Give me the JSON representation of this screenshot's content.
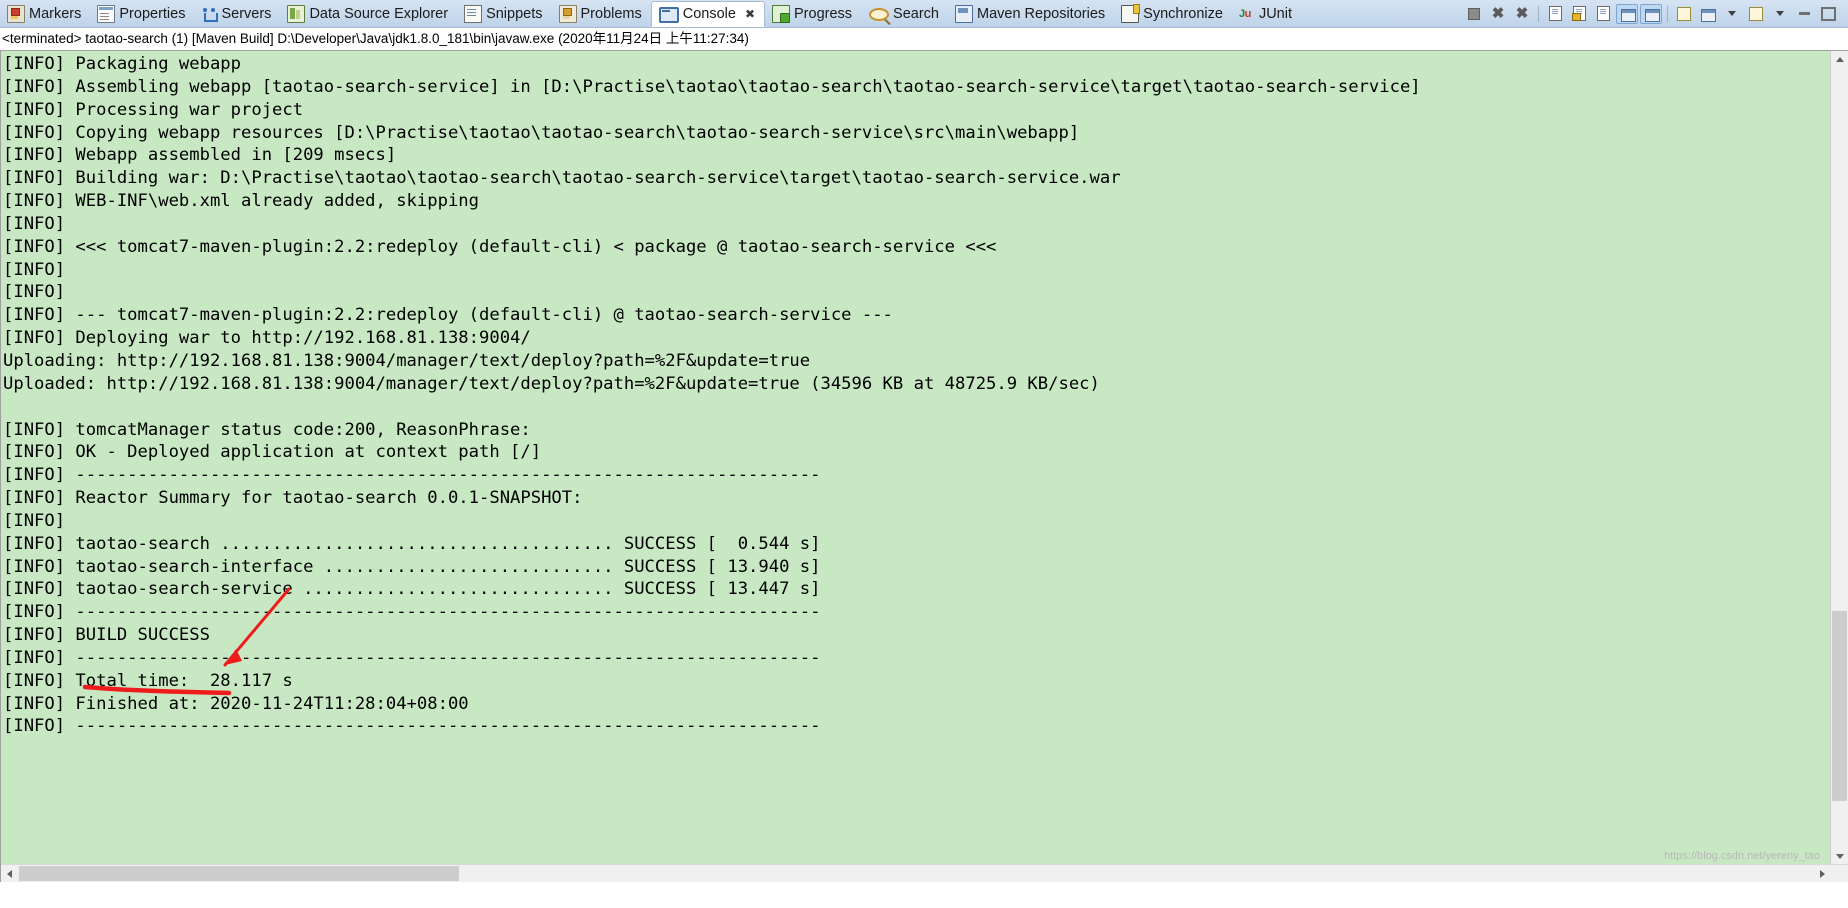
{
  "tabs": [
    {
      "label": "Markers",
      "icon": "marker-icon",
      "active": false
    },
    {
      "label": "Properties",
      "icon": "properties-icon",
      "active": false
    },
    {
      "label": "Servers",
      "icon": "servers-icon",
      "active": false
    },
    {
      "label": "Data Source Explorer",
      "icon": "datasource-icon",
      "active": false
    },
    {
      "label": "Snippets",
      "icon": "snippets-icon",
      "active": false
    },
    {
      "label": "Problems",
      "icon": "problems-icon",
      "active": false
    },
    {
      "label": "Console",
      "icon": "console-icon",
      "active": true
    },
    {
      "label": "Progress",
      "icon": "progress-icon",
      "active": false
    },
    {
      "label": "Search",
      "icon": "search-icon",
      "active": false
    },
    {
      "label": "Maven Repositories",
      "icon": "maven-icon",
      "active": false
    },
    {
      "label": "Synchronize",
      "icon": "sync-icon",
      "active": false
    },
    {
      "label": "JUnit",
      "icon": "junit-icon",
      "active": false
    }
  ],
  "toolbar": {
    "buttons": [
      "terminate-icon",
      "remove-launch-icon",
      "remove-all-terminated-icon",
      "clear-console-icon",
      "scroll-lock-icon",
      "word-wrap-icon",
      "show-console-on-output-icon",
      "show-console-on-error-icon",
      "pin-console-icon",
      "display-selected-console-icon",
      "display-selected-console-menu-icon",
      "open-console-icon",
      "open-console-menu-icon",
      "minimize-icon",
      "maximize-icon"
    ]
  },
  "console": {
    "header": "<terminated> taotao-search (1) [Maven Build] D:\\Developer\\Java\\jdk1.8.0_181\\bin\\javaw.exe (2020年11月24日 上午11:27:34)",
    "background_color": "#c8e8c4",
    "lines": [
      "[INFO] Packaging webapp",
      "[INFO] Assembling webapp [taotao-search-service] in [D:\\Practise\\taotao\\taotao-search\\taotao-search-service\\target\\taotao-search-service]",
      "[INFO] Processing war project",
      "[INFO] Copying webapp resources [D:\\Practise\\taotao\\taotao-search\\taotao-search-service\\src\\main\\webapp]",
      "[INFO] Webapp assembled in [209 msecs]",
      "[INFO] Building war: D:\\Practise\\taotao\\taotao-search\\taotao-search-service\\target\\taotao-search-service.war",
      "[INFO] WEB-INF\\web.xml already added, skipping",
      "[INFO] ",
      "[INFO] <<< tomcat7-maven-plugin:2.2:redeploy (default-cli) < package @ taotao-search-service <<<",
      "[INFO] ",
      "[INFO] ",
      "[INFO] --- tomcat7-maven-plugin:2.2:redeploy (default-cli) @ taotao-search-service ---",
      "[INFO] Deploying war to http://192.168.81.138:9004/",
      "Uploading: http://192.168.81.138:9004/manager/text/deploy?path=%2F&update=true",
      "Uploaded: http://192.168.81.138:9004/manager/text/deploy?path=%2F&update=true (34596 KB at 48725.9 KB/sec)",
      "",
      "[INFO] tomcatManager status code:200, ReasonPhrase:",
      "[INFO] OK - Deployed application at context path [/]",
      "[INFO] ------------------------------------------------------------------------",
      "[INFO] Reactor Summary for taotao-search 0.0.1-SNAPSHOT:",
      "[INFO] ",
      "[INFO] taotao-search ...................................... SUCCESS [  0.544 s]",
      "[INFO] taotao-search-interface ............................ SUCCESS [ 13.940 s]",
      "[INFO] taotao-search-service .............................. SUCCESS [ 13.447 s]",
      "[INFO] ------------------------------------------------------------------------",
      "[INFO] BUILD SUCCESS",
      "[INFO] ------------------------------------------------------------------------",
      "[INFO] Total time:  28.117 s",
      "[INFO] Finished at: 2020-11-24T11:28:04+08:00",
      "[INFO] ------------------------------------------------------------------------"
    ],
    "highlight": {
      "text": "BUILD SUCCESS",
      "color": "#ee1c1c",
      "type": "red-underline-with-arrow"
    }
  },
  "watermark": "https://blog.csdn.net/yereny_tao"
}
